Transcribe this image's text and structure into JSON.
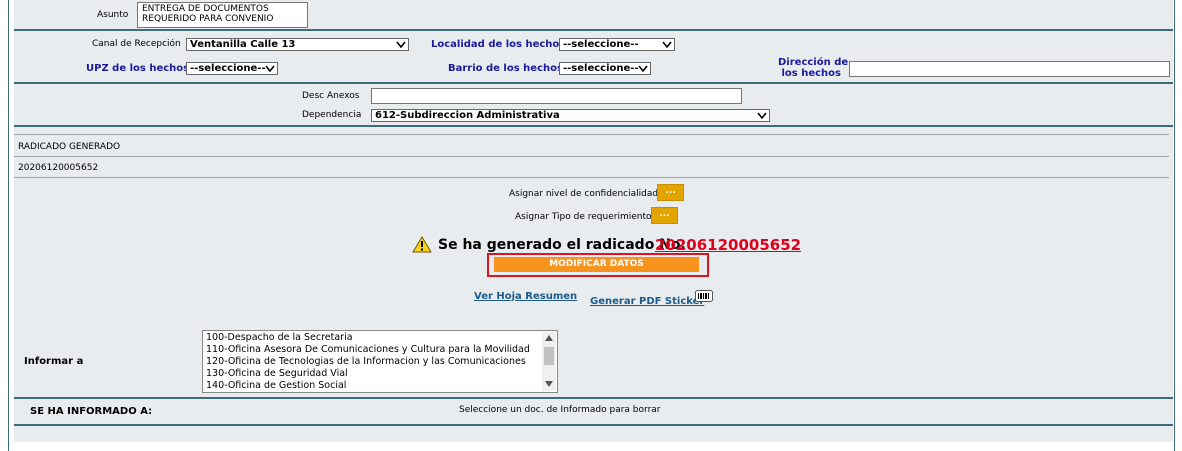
{
  "asunto": {
    "label": "Asunto",
    "value_line1": "ENTREGA DE DOCUMENTOS",
    "value_line2": "REQUERIDO PARA CONVENIO"
  },
  "canal": {
    "label": "Canal de Recepción",
    "value": "Ventanilla Calle 13"
  },
  "localidad": {
    "label": "Localidad de los hechos",
    "value": "--seleccione--"
  },
  "upz": {
    "label": "UPZ de los hechos",
    "value": "--seleccione--"
  },
  "barrio": {
    "label": "Barrio de los hechos",
    "value": "--seleccione--"
  },
  "direccion": {
    "label_line1": "Dirección de",
    "label_line2": "los hechos",
    "value": ""
  },
  "desc_anexos": {
    "label": "Desc Anexos",
    "value": ""
  },
  "dependencia": {
    "label": "Dependencia",
    "value": "612-Subdireccion Administrativa"
  },
  "radicado": {
    "header": "RADICADO GENERADO",
    "number": "20206120005652"
  },
  "confidencialidad": {
    "label": "Asignar nivel de confidencialidad:",
    "button": "..."
  },
  "tipo_req": {
    "label": "Asignar Tipo de requerimiento:",
    "button": "..."
  },
  "message": {
    "text": "Se ha generado el radicado No.",
    "number": "20206120005652"
  },
  "modificar_button": "MODIFICAR DATOS",
  "links": {
    "hoja_resumen": "Ver Hoja Resumen",
    "pdf_sticker": "Generar PDF Sticker"
  },
  "informar": {
    "label": "Informar a",
    "options": [
      "100-Despacho de la Secretaria",
      "110-Oficina Asesora De Comunicaciones y Cultura para la Movilidad",
      "120-Oficina de Tecnologias de la Informacion y las Comunicaciones",
      "130-Oficina de Seguridad Vial",
      "140-Oficina de Gestion Social"
    ]
  },
  "informado": {
    "label": "SE HA INFORMADO A:",
    "hint": "Seleccione un doc. de Informado para borrar"
  },
  "colors": {
    "panel": "#e8ecef",
    "border": "#3c6e77",
    "accent_orange": "#f7941d",
    "radicado_red": "#e0001b",
    "link_blue": "#1d5b8a",
    "label_blue": "#1a1a9c"
  }
}
